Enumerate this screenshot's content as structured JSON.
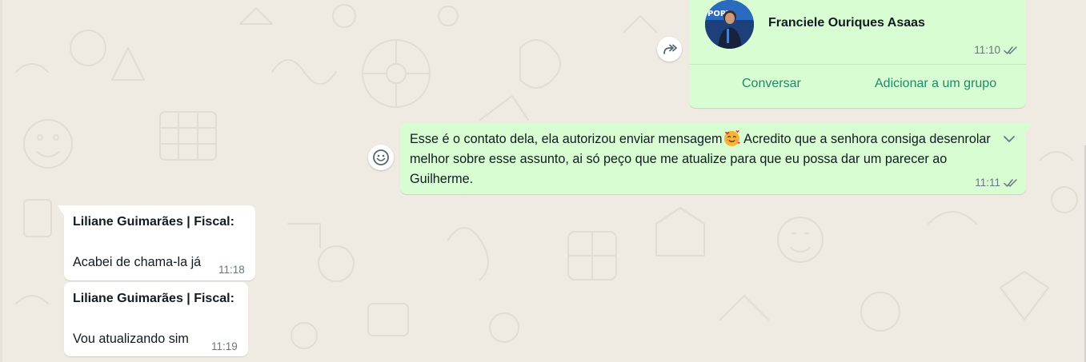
{
  "colors": {
    "wallpaper": "#efeae2",
    "outgoing_bubble": "#d9fdd3",
    "incoming_bubble": "#ffffff",
    "action_text": "#1d8a6b",
    "meta_text": "#667781",
    "read_check": "#667781"
  },
  "contact_card": {
    "name": "Franciele Ouriques Asaas",
    "time": "11:10",
    "status_icon": "double-check-icon",
    "actions": {
      "chat_label": "Conversar",
      "add_group_label": "Adicionar a um grupo"
    },
    "forward_icon": "forward-icon"
  },
  "outgoing_message": {
    "text_before_emoji": "Esse é o contato dela, ela autorizou enviar mensagem",
    "emoji": "smiling-face-with-hearts",
    "text_after_emoji": " Acredito que a senhora consiga desenrolar melhor sobre esse assunto, ai só peço que me atualize para que eu possa dar um parecer ao Guilherme.",
    "time": "11:11",
    "status_icon": "double-check-icon",
    "menu_icon": "chevron-down-icon",
    "react_icon": "smiley-icon"
  },
  "incoming_messages": [
    {
      "sender": "Liliane Guimarães | Fiscal:",
      "text": "Acabei de chama-la já",
      "time": "11:18"
    },
    {
      "sender": "Liliane Guimarães | Fiscal:",
      "text": "Vou atualizando sim",
      "time": "11:19"
    }
  ]
}
